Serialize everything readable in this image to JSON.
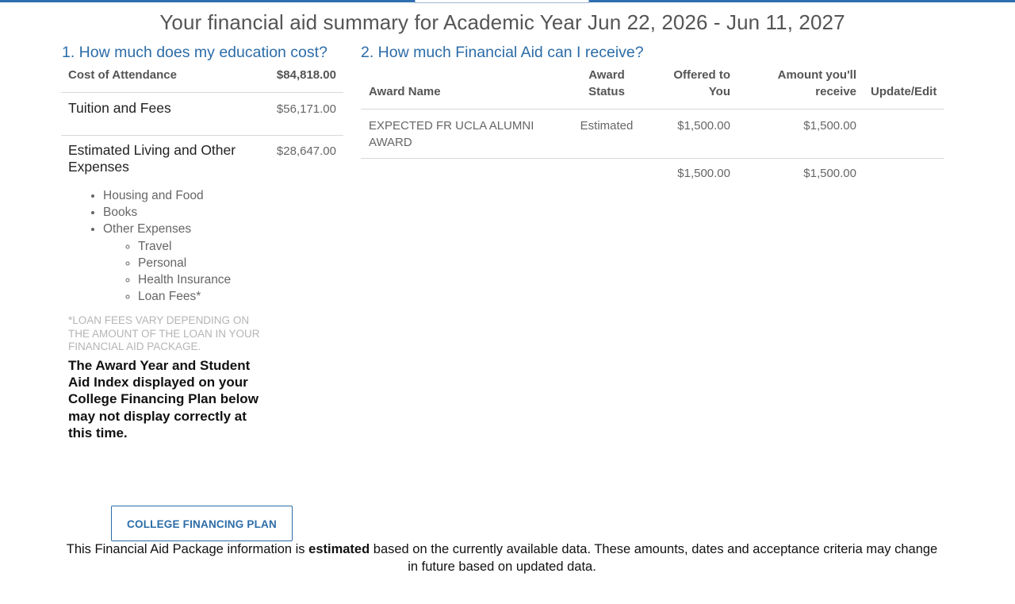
{
  "page": {
    "title": "Your financial aid summary for Academic Year Jun 22, 2026 - Jun 11, 2027"
  },
  "cost_section": {
    "heading": "1. How much does my education cost?",
    "header_label": "Cost of Attendance",
    "header_value": "$84,818.00",
    "rows": [
      {
        "label": "Tuition and Fees",
        "value": "$56,171.00"
      },
      {
        "label": "Estimated Living and Other Expenses",
        "value": "$28,647.00"
      }
    ],
    "expenses": [
      "Housing and Food",
      "Books",
      "Other Expenses"
    ],
    "other_expenses": [
      "Travel",
      "Personal",
      "Health Insurance",
      "Loan Fees*"
    ],
    "loan_note": "*LOAN FEES VARY DEPENDING ON THE AMOUNT OF THE LOAN IN YOUR FINANCIAL AID PACKAGE.",
    "warning": "The Award Year and Student Aid Index displayed on your College Financing Plan below may not display correctly at this time."
  },
  "aid_section": {
    "heading": "2. How much Financial Aid can I receive?",
    "columns": {
      "name": "Award Name",
      "status": "Award Status",
      "offered": "Offered to You",
      "receive": "Amount you'll receive",
      "update": "Update/Edit"
    },
    "rows": [
      {
        "name": "EXPECTED FR UCLA ALUMNI AWARD",
        "status": "Estimated",
        "offered": "$1,500.00",
        "receive": "$1,500.00"
      }
    ],
    "totals": {
      "offered": "$1,500.00",
      "receive": "$1,500.00"
    }
  },
  "cfp_button": "COLLEGE FINANCING PLAN",
  "disclaimer": {
    "before": "This Financial Aid Package information is ",
    "emphasis": "estimated",
    "after": " based on the currently available data. These amounts, dates and acceptance criteria may change in future based on updated data."
  },
  "colors": {
    "accent": "#2b6ca8",
    "topbar": "#2f6fb0",
    "muted": "#666666",
    "note": "#b5b5b5"
  }
}
